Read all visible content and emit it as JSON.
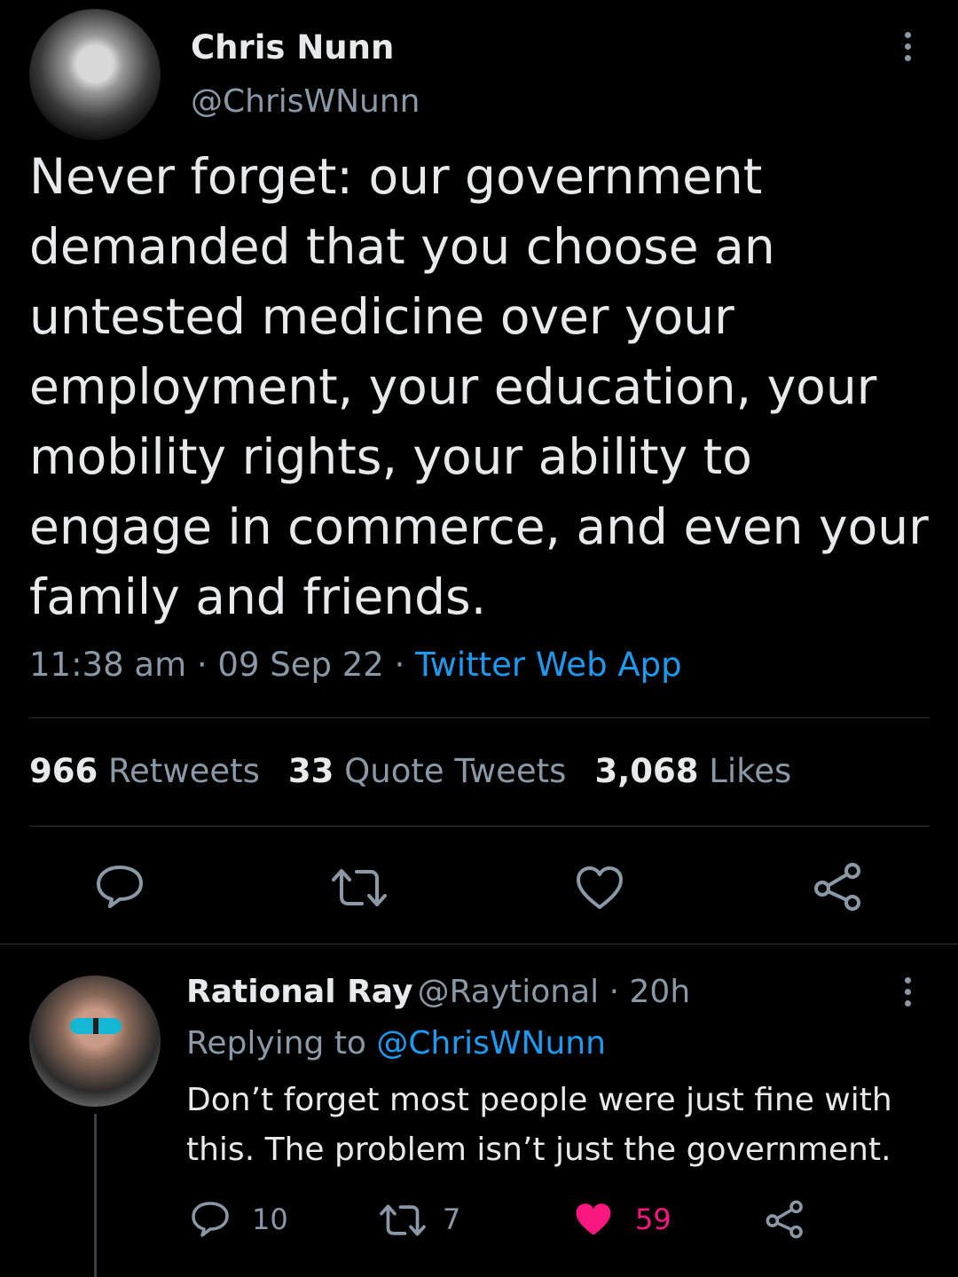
{
  "tweet": {
    "author_name": "Chris Nunn",
    "author_handle": "@ChrisWNunn",
    "text": "Never forget: our government demanded that you choose an untested medicine over your employment, your education, your mobility rights, your ability to engage in commerce, and even your family and friends.",
    "time": "11:38 am",
    "separator": " · ",
    "date": "09 Sep 22",
    "source": "Twitter Web App",
    "stats": {
      "retweets_count": "966",
      "retweets_label": "Retweets",
      "quotes_count": "33",
      "quotes_label": "Quote Tweets",
      "likes_count": "3,068",
      "likes_label": "Likes"
    },
    "actions": [
      "reply-icon",
      "retweet-icon",
      "like-icon",
      "share-icon"
    ]
  },
  "reply": {
    "author_name": "Rational Ray",
    "author_handle": "@Raytional",
    "separator": " · ",
    "age": "20h",
    "replying_label": "Replying to ",
    "replying_to": "@ChrisWNunn",
    "text": "Don’t forget most people were just fine with this. The problem isn’t just the government.",
    "counts": {
      "replies": "10",
      "retweets": "7",
      "likes": "59"
    },
    "liked": true
  },
  "colors": {
    "background": "#000000",
    "text": "#e7e9ea",
    "secondary": "#8b98a5",
    "accent": "#1d9bf0",
    "like": "#f91880"
  }
}
